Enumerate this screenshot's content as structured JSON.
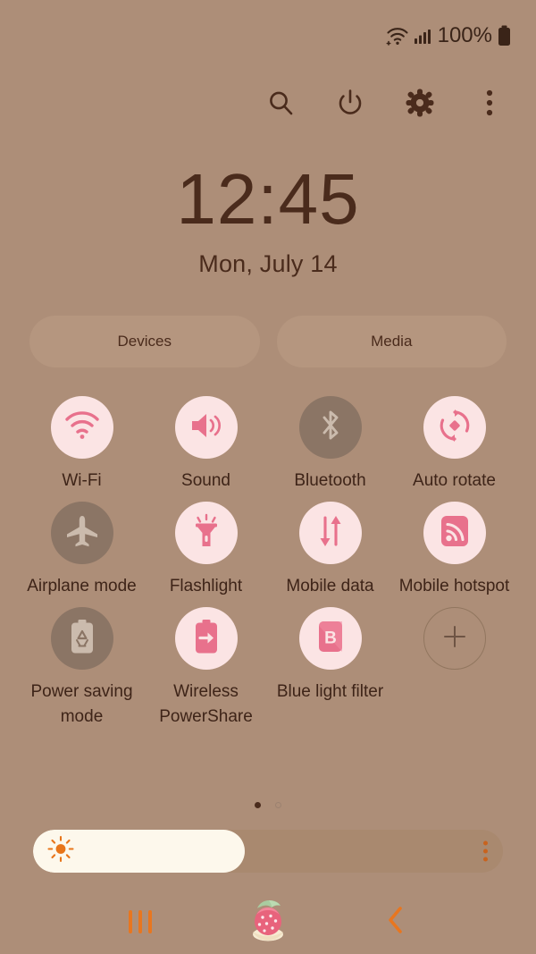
{
  "statusbar": {
    "battery_percent": "100%",
    "wifi_icon": "wifi-icon",
    "signal_icon": "cellular-signal-icon",
    "battery_icon": "battery-full-icon"
  },
  "header": {
    "buttons": [
      {
        "name": "search-button",
        "icon": "search-icon"
      },
      {
        "name": "power-button",
        "icon": "power-icon"
      },
      {
        "name": "settings-button",
        "icon": "gear-icon"
      },
      {
        "name": "more-options-button",
        "icon": "overflow-menu-icon"
      }
    ]
  },
  "clock": {
    "time": "12:45",
    "date": "Mon, July 14"
  },
  "pills": [
    {
      "label": "Devices",
      "name": "devices-button"
    },
    {
      "label": "Media",
      "name": "media-button"
    }
  ],
  "toggles": [
    {
      "label": "Wi-Fi",
      "icon": "wifi-icon",
      "state": "on"
    },
    {
      "label": "Sound",
      "icon": "sound-icon",
      "state": "on"
    },
    {
      "label": "Bluetooth",
      "icon": "bluetooth-icon",
      "state": "off"
    },
    {
      "label": "Auto rotate",
      "icon": "auto-rotate-icon",
      "state": "on"
    },
    {
      "label": "Airplane mode",
      "icon": "airplane-icon",
      "state": "off"
    },
    {
      "label": "Flashlight",
      "icon": "flashlight-icon",
      "state": "on"
    },
    {
      "label": "Mobile data",
      "icon": "mobile-data-icon",
      "state": "on"
    },
    {
      "label": "Mobile hotspot",
      "icon": "mobile-hotspot-icon",
      "state": "on"
    },
    {
      "label": "Power saving mode",
      "icon": "power-saving-icon",
      "state": "off"
    },
    {
      "label": "Wireless PowerShare",
      "icon": "wireless-powershare-icon",
      "state": "on"
    },
    {
      "label": "Blue light filter",
      "icon": "blue-light-filter-icon",
      "state": "on"
    },
    {
      "label": "",
      "icon": "add-icon",
      "state": "add"
    }
  ],
  "pagination": {
    "pages": 2,
    "active_index": 0
  },
  "brightness": {
    "value_percent": 45,
    "sun_icon": "brightness-sun-icon",
    "menu_icon": "overflow-menu-icon"
  },
  "navbar": {
    "recents": {
      "label": "recents-icon"
    },
    "home": {
      "label": "strawberry-home-icon"
    },
    "back": {
      "label": "back-chevron-icon"
    }
  },
  "colors": {
    "background": "#AD8E78",
    "pill_bg": "#B5967F",
    "toggle_on_bg": "#FBE4E4",
    "toggle_off_bg": "#8B7565",
    "accent_pink": "#E8718C",
    "text_dark": "#3E2418",
    "slider_fill": "#FDF8EC",
    "slider_track": "#A9896F",
    "nav_orange": "#E8761F",
    "sun_orange": "#E8751A"
  }
}
